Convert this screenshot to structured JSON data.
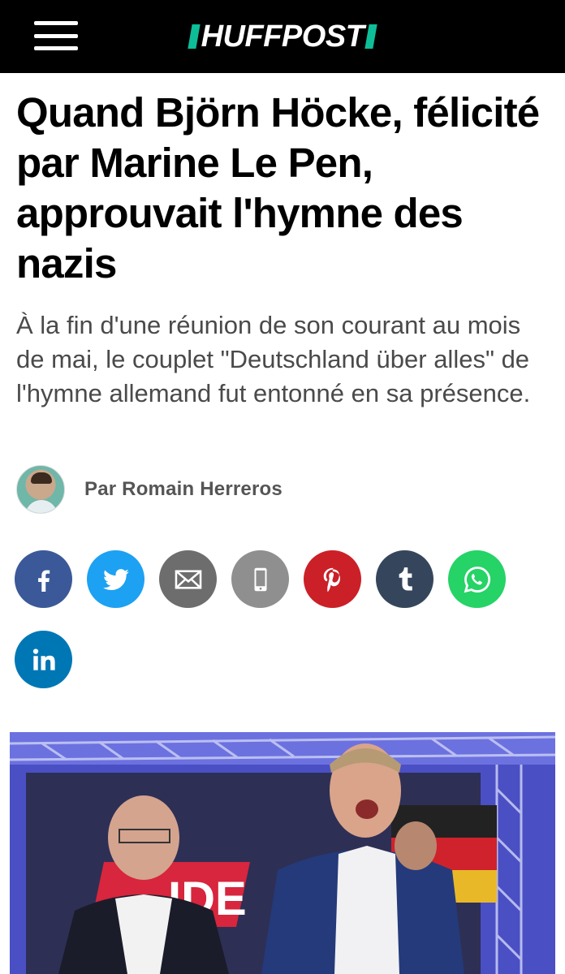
{
  "header": {
    "menu_icon": "hamburger-menu-icon",
    "logo_text": "HUFFPOST",
    "brand_color": "#0dbe98"
  },
  "article": {
    "headline": "Quand Björn Höcke, félicité par Marine Le Pen, approuvait l'hymne des nazis",
    "standfirst": "À la fin d'une réunion de son courant au mois de mai, le couplet \"Deutschland über alles\" de l'hymne allemand fut entonné en sa présence.",
    "author": "Par Romain Herreros"
  },
  "share": [
    {
      "icon": "facebook-icon",
      "color": "#3b5998"
    },
    {
      "icon": "twitter-icon",
      "color": "#1da1f2"
    },
    {
      "icon": "email-icon",
      "color": "#6d6d6d"
    },
    {
      "icon": "sms-icon",
      "color": "#8f8f8f"
    },
    {
      "icon": "pinterest-icon",
      "color": "#cb2027"
    },
    {
      "icon": "tumblr-icon",
      "color": "#35465c"
    },
    {
      "icon": "whatsapp-icon",
      "color": "#25d366"
    },
    {
      "icon": "linkedin-icon",
      "color": "#0077b5"
    }
  ],
  "hero_image": {
    "banner_text": "IDE"
  }
}
